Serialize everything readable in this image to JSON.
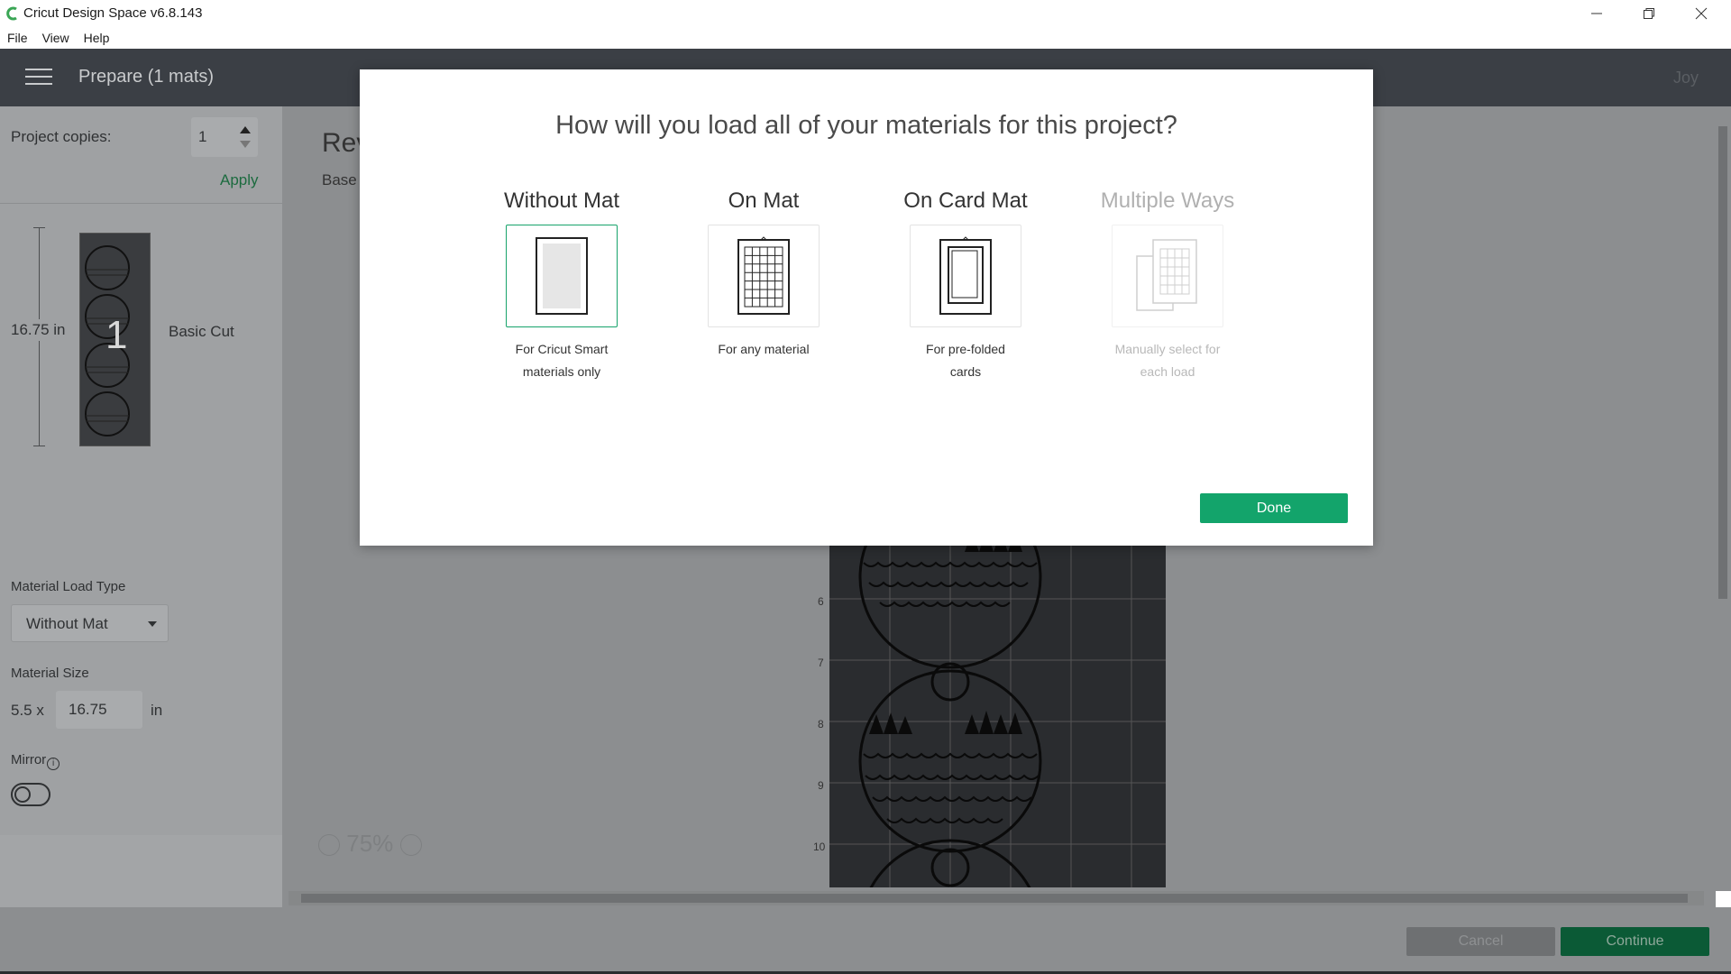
{
  "window": {
    "title": "Cricut Design Space  v6.8.143",
    "controls": [
      "minimize-icon",
      "restore-icon",
      "close-icon"
    ]
  },
  "menu": {
    "items": [
      "File",
      "View",
      "Help"
    ]
  },
  "header": {
    "title": "Prepare (1 mats)",
    "user": "Joy"
  },
  "left_panel": {
    "copies_label": "Project copies:",
    "copies_value": "1",
    "apply_label": "Apply",
    "mat_length": "16.75 in",
    "mat_number": "1",
    "mat_cut_type": "Basic Cut",
    "load_type_label": "Material Load Type",
    "load_type_value": "Without Mat",
    "size_label": "Material Size",
    "size_width": "5.5 x",
    "size_height": "16.75",
    "size_unit": "in",
    "mirror_label": "Mirror"
  },
  "main": {
    "heading": "Rev",
    "subheading": "Base",
    "ruler_numbers": [
      "6",
      "7",
      "8",
      "9",
      "10"
    ],
    "zoom": "75%"
  },
  "footer": {
    "cancel_label": "Cancel",
    "continue_label": "Continue"
  },
  "modal": {
    "title": "How will you load all of your materials for this project?",
    "options": [
      {
        "title": "Without Mat",
        "desc1": "For Cricut Smart",
        "desc2": "materials only",
        "selected": true,
        "disabled": false,
        "icon": "without-mat-icon"
      },
      {
        "title": "On Mat",
        "desc1": "For any material",
        "desc2": "",
        "selected": false,
        "disabled": false,
        "icon": "on-mat-icon"
      },
      {
        "title": "On Card Mat",
        "desc1": "For pre-folded",
        "desc2": "cards",
        "selected": false,
        "disabled": false,
        "icon": "card-mat-icon"
      },
      {
        "title": "Multiple Ways",
        "desc1": "Manually select for",
        "desc2": "each load",
        "selected": false,
        "disabled": true,
        "icon": "multiple-ways-icon"
      }
    ],
    "done_label": "Done"
  },
  "colors": {
    "accent": "#13a46b",
    "header_bg": "#3b3f45",
    "overlay_gray": "#8c8e90"
  }
}
